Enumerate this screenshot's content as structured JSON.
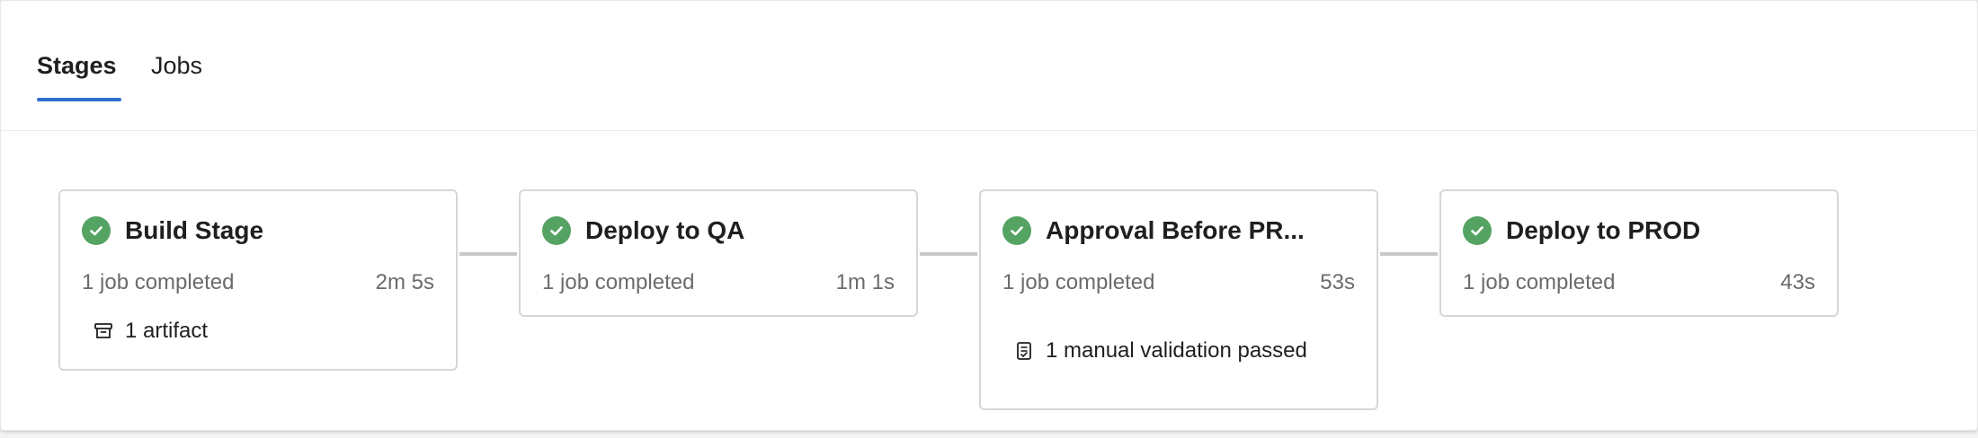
{
  "tabs": [
    {
      "label": "Stages",
      "active": true
    },
    {
      "label": "Jobs",
      "active": false
    }
  ],
  "stages": [
    {
      "title": "Build Stage",
      "status": "1 job completed",
      "duration": "2m 5s",
      "extra": "1 artifact",
      "extra_icon": "archive-icon",
      "result_icon": "success-check-icon"
    },
    {
      "title": "Deploy to QA",
      "status": "1 job completed",
      "duration": "1m 1s",
      "result_icon": "success-check-icon"
    },
    {
      "title": "Approval Before PR...",
      "status": "1 job completed",
      "duration": "53s",
      "extra": "1 manual validation passed",
      "extra_icon": "checklist-icon",
      "result_icon": "success-check-icon"
    },
    {
      "title": "Deploy to PROD",
      "status": "1 job completed",
      "duration": "43s",
      "result_icon": "success-check-icon"
    }
  ],
  "colors": {
    "accent": "#2f6fd1",
    "success": "#55a362",
    "border": "#d6d6d6",
    "muted_text": "#6b6b6b"
  }
}
